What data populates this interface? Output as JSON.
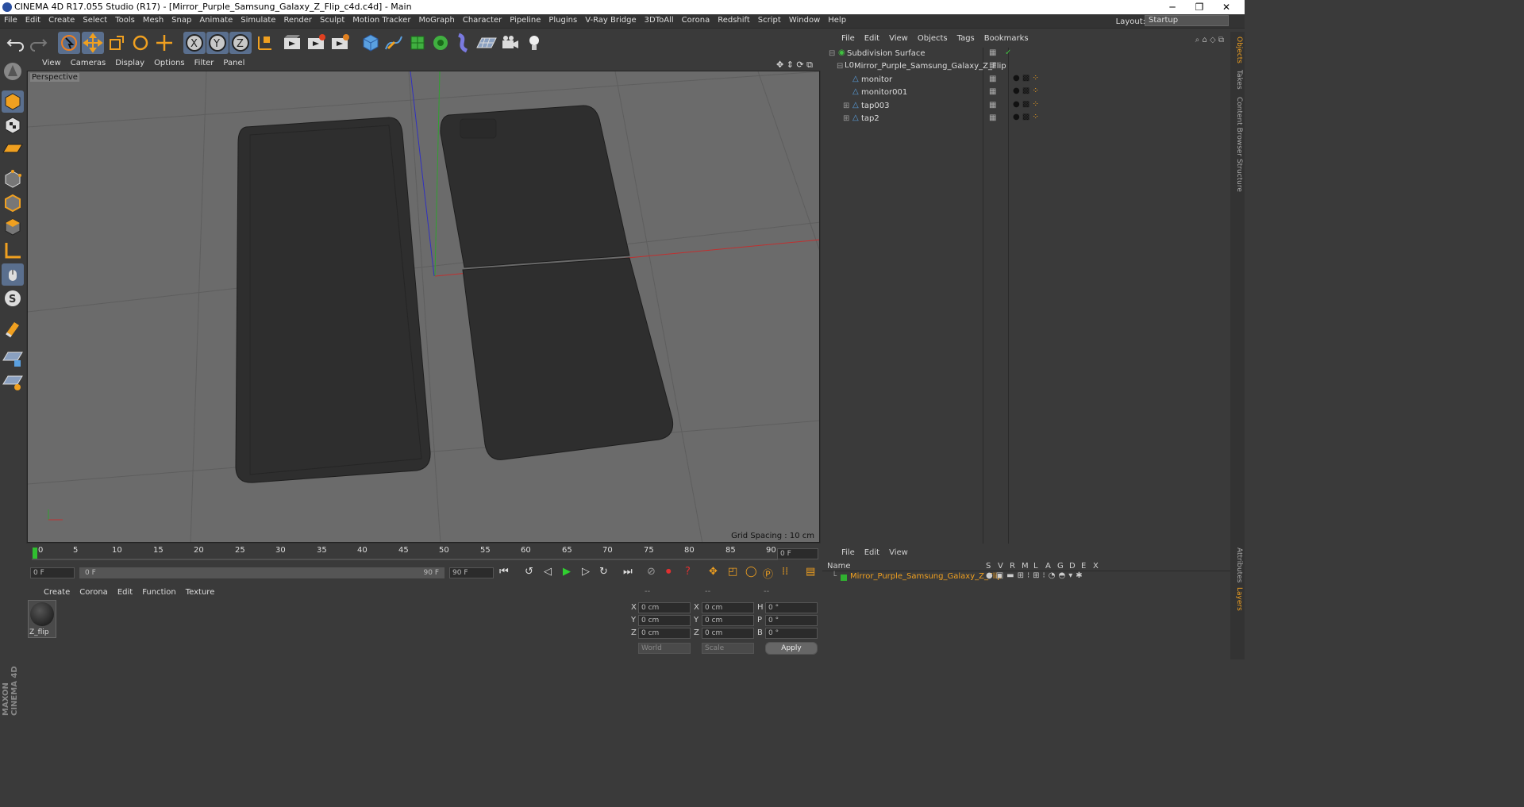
{
  "window": {
    "title": "CINEMA 4D R17.055 Studio (R17) - [Mirror_Purple_Samsung_Galaxy_Z_Flip_c4d.c4d] - Main",
    "minimize": "─",
    "maximize": "❐",
    "close": "✕"
  },
  "menubar": {
    "items": [
      "File",
      "Edit",
      "Create",
      "Select",
      "Tools",
      "Mesh",
      "Snap",
      "Animate",
      "Simulate",
      "Render",
      "Sculpt",
      "Motion Tracker",
      "MoGraph",
      "Character",
      "Pipeline",
      "Plugins",
      "V-Ray Bridge",
      "3DToAll",
      "Corona",
      "Redshift",
      "Script",
      "Window",
      "Help"
    ],
    "layout_label": "Layout:",
    "layout_value": "Startup"
  },
  "viewport": {
    "menu": [
      "View",
      "Cameras",
      "Display",
      "Options",
      "Filter",
      "Panel"
    ],
    "camera": "Perspective",
    "grid_spacing": "Grid Spacing : 10 cm"
  },
  "object_manager": {
    "menu": [
      "File",
      "Edit",
      "View",
      "Objects",
      "Tags",
      "Bookmarks"
    ],
    "objects": [
      {
        "name": "Subdivision Surface"
      },
      {
        "name": "Mirror_Purple_Samsung_Galaxy_Z_Flip"
      },
      {
        "name": "monitor"
      },
      {
        "name": "monitor001"
      },
      {
        "name": "tap003"
      },
      {
        "name": "tap2"
      }
    ]
  },
  "right_tabs": [
    "Objects",
    "Takes",
    "Content Browser",
    "Structure",
    "Attributes",
    "Layers"
  ],
  "timeline": {
    "ticks": [
      "0",
      "5",
      "10",
      "15",
      "20",
      "25",
      "30",
      "35",
      "40",
      "45",
      "50",
      "55",
      "60",
      "65",
      "70",
      "75",
      "80",
      "85",
      "90"
    ],
    "current_frame": "0 F",
    "start_field": "0 F",
    "range_start": "0 F",
    "range_end": "90 F",
    "end_field": "90 F"
  },
  "material_manager": {
    "menu": [
      "Create",
      "Corona",
      "Edit",
      "Function",
      "Texture"
    ],
    "materials": [
      {
        "name": "Z_flip"
      }
    ]
  },
  "coordinates": {
    "headers": [
      "--",
      "--",
      "--"
    ],
    "rows": [
      {
        "a": "X",
        "av": "0 cm",
        "b": "X",
        "bv": "0 cm",
        "c": "H",
        "cv": "0 °"
      },
      {
        "a": "Y",
        "av": "0 cm",
        "b": "Y",
        "bv": "0 cm",
        "c": "P",
        "cv": "0 °"
      },
      {
        "a": "Z",
        "av": "0 cm",
        "b": "Z",
        "bv": "0 cm",
        "c": "B",
        "cv": "0 °"
      }
    ],
    "mode": "World",
    "type": "Scale",
    "apply": "Apply"
  },
  "layer_manager": {
    "menu": [
      "File",
      "Edit",
      "View"
    ],
    "name_header": "Name",
    "columns": [
      "S",
      "V",
      "R",
      "M",
      "L",
      "A",
      "G",
      "D",
      "E",
      "X"
    ],
    "layers": [
      {
        "name": "Mirror_Purple_Samsung_Galaxy_Z_Flip"
      }
    ]
  },
  "brand": "MAXON CINEMA 4D"
}
